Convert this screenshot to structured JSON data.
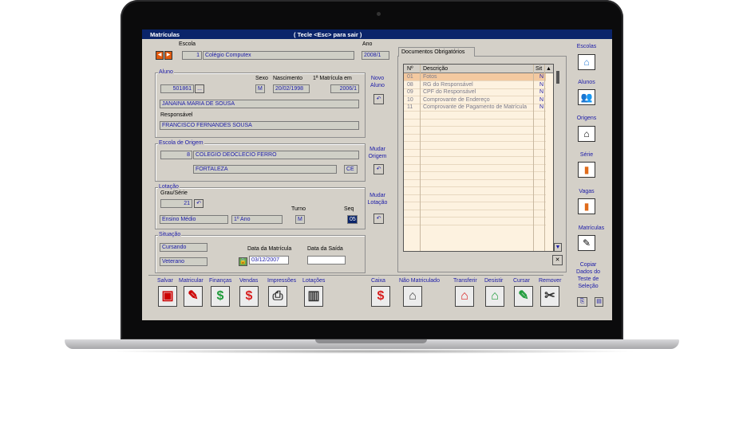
{
  "window": {
    "title": "Matrículas",
    "hint": "( Tecle <Esc> para sair )"
  },
  "escola": {
    "label": "Escola",
    "code": "1",
    "name": "Colégio Computex"
  },
  "ano": {
    "label": "Ano",
    "value": "2008/1"
  },
  "aluno": {
    "group": "Aluno",
    "code": "501861",
    "lookup": "...",
    "sexo_label": "Sexo",
    "sexo": "M",
    "nasc_label": "Nascimento",
    "nasc": "20/02/1998",
    "mat1_label": "1ª Matrícula em",
    "mat1": "2006/1",
    "name": "JANAINA MARIA DE SOUSA",
    "resp_label": "Responsável",
    "resp": "FRANCISCO FERNANDES SOUSA",
    "novo_label1": "Novo",
    "novo_label2": "Aluno"
  },
  "origem": {
    "group": "Escola de Origem",
    "code": "8",
    "name": "COLEGIO DEOCLECIO FERRO",
    "city": "FORTALEZA",
    "uf": "CE",
    "mudar1": "Mudar",
    "mudar2": "Origem"
  },
  "lotacao": {
    "group": "Lotação",
    "grau_label": "Grau/Série",
    "code": "21",
    "turno_label": "Turno",
    "turno": "M",
    "seq_label": "Seq",
    "seq": "05",
    "grau": "Ensino Médio",
    "serie": "1º Ano",
    "mudar1": "Mudar",
    "mudar2": "Lotação"
  },
  "situacao": {
    "group": "Situação",
    "status": "Cursando",
    "tipo": "Veterano",
    "data_mat_label": "Data da Matrícula",
    "data_mat": "03/12/2007",
    "data_saida_label": "Data da Saída",
    "data_saida": ""
  },
  "docs": {
    "tab": "Documentos Obrigatórios",
    "headers": {
      "n": "Nº",
      "desc": "Descrição",
      "sit": "Sit"
    },
    "rows": [
      {
        "n": "01",
        "desc": "Fotos",
        "sit": "N"
      },
      {
        "n": "08",
        "desc": "RG do Responsável",
        "sit": "N"
      },
      {
        "n": "09",
        "desc": "CPF do Responsável",
        "sit": "N"
      },
      {
        "n": "10",
        "desc": "Comprovante de Endereço",
        "sit": "N"
      },
      {
        "n": "11",
        "desc": "Comprovante de Pagamento de Matrícula",
        "sit": "N"
      }
    ]
  },
  "sidebar": {
    "escolas": "Escolas",
    "alunos": "Alunos",
    "origens": "Origens",
    "serie": "Série",
    "vagas": "Vagas",
    "matriculas": "Matrículas",
    "copiar": [
      "Copiar",
      "Dados do",
      "Teste de",
      "Seleção"
    ]
  },
  "toolbar": {
    "salvar": "Salvar",
    "matricular": "Matricular",
    "financas": "Finanças",
    "vendas": "Vendas",
    "impressoes": "Impressões",
    "lotacoes": "Lotações",
    "caixa": "Caixa",
    "nao_matriculado": "Não Matriculado",
    "transferir": "Transferir",
    "desistir": "Desistir",
    "cursar": "Cursar",
    "remover": "Remover"
  },
  "colors": {
    "title_bar": "#0a246a",
    "label_blue": "#1a1aa8",
    "grid_bg": "#fdf2e0",
    "money_green": "#1e9b3a",
    "money_red": "#d81e1e"
  }
}
